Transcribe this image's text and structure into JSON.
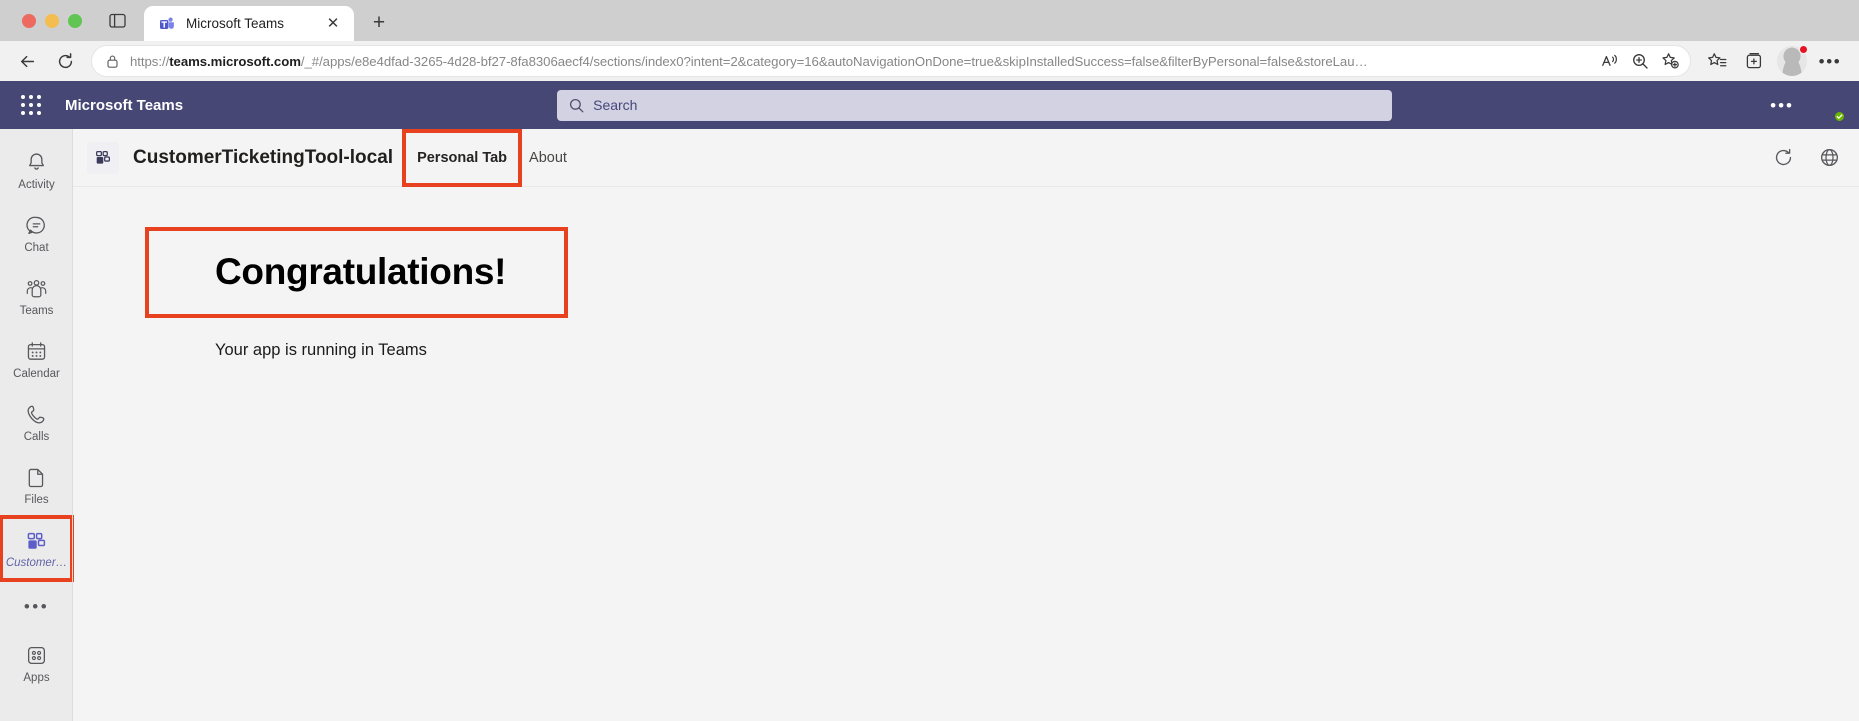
{
  "browser": {
    "tab": {
      "title": "Microsoft Teams",
      "favicon": "teams-favicon",
      "close": "✕"
    },
    "new_tab_label": "+",
    "url": {
      "scheme": "https://",
      "host": "teams.microsoft.com",
      "path": "/_#/apps/e8e4dfad-3265-4d28-bf27-8fa8306aecf4/sections/index0?intent=2&category=16&autoNavigationOnDone=true&skipInstalledSuccess=false&filterByPersonal=false&storeLau…",
      "full": "https://teams.microsoft.com/_#/apps/e8e4dfad-3265-4d28-bf27-8fa8306aecf4/sections/index0?intent=2&category=16&autoNavigationOnDone=true&skipInstalledSuccess=false&filterByPersonal=false&storeLau…"
    },
    "toolbar": {
      "back": "back-arrow",
      "reload": "reload",
      "lock": "site-lock",
      "read_aloud": "read-aloud",
      "zoom": "zoom",
      "add_favorite": "add-favorite",
      "favorites": "favorites",
      "collections": "collections",
      "profile": "profile",
      "settings_more": "•••"
    }
  },
  "teams": {
    "brand": "Microsoft Teams",
    "waffle": "app-launcher",
    "search": {
      "placeholder": "Search",
      "value": ""
    },
    "more_options": "•••",
    "avatar": "user-avatar",
    "presence": "available"
  },
  "rail": {
    "items": [
      {
        "label": "Activity",
        "icon": "bell-icon",
        "selected": false
      },
      {
        "label": "Chat",
        "icon": "chat-icon",
        "selected": false
      },
      {
        "label": "Teams",
        "icon": "teams-icon",
        "selected": false
      },
      {
        "label": "Calendar",
        "icon": "calendar-icon",
        "selected": false
      },
      {
        "label": "Calls",
        "icon": "calls-icon",
        "selected": false
      },
      {
        "label": "Files",
        "icon": "files-icon",
        "selected": false
      },
      {
        "label": "Customer…",
        "icon": "app-grid-icon",
        "selected": true
      }
    ],
    "more": "•••",
    "apps": {
      "label": "Apps",
      "icon": "apps-icon"
    }
  },
  "app": {
    "icon": "app-grid-icon",
    "title": "CustomerTicketingTool-local",
    "tabs": [
      {
        "label": "Personal Tab",
        "active": true
      },
      {
        "label": "About",
        "active": false
      }
    ],
    "header_actions": {
      "refresh": "refresh-icon",
      "website": "globe-icon"
    }
  },
  "content": {
    "heading": "Congratulations!",
    "subtext": "Your app is running in Teams"
  },
  "colors": {
    "teams_purple": "#464775",
    "accent_purple": "#6264a7",
    "annotation_red": "#e8411f",
    "search_bg": "#d2d2e3",
    "presence_green": "#6bb700"
  }
}
